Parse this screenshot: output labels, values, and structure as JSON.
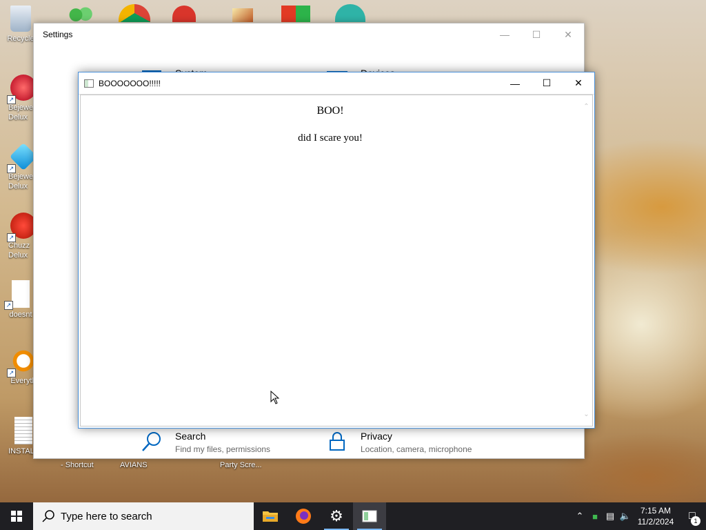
{
  "desktop": {
    "icons": [
      {
        "label": "Recycle"
      },
      {
        "label": "Bejewe Delux"
      },
      {
        "label": "Bejewe Delux"
      },
      {
        "label": "Chuzz Delux"
      },
      {
        "label": "doesnt"
      },
      {
        "label": "Everyth"
      },
      {
        "label": "INSTALL"
      }
    ],
    "bottom_labels": [
      "- Shortcut",
      "AVIANS",
      "Party Scre..."
    ]
  },
  "settings": {
    "title": "Settings",
    "tiles": {
      "system": {
        "name": "System"
      },
      "devices": {
        "name": "Devices"
      },
      "search": {
        "name": "Search",
        "desc": "Find my files, permissions"
      },
      "privacy": {
        "name": "Privacy",
        "desc": "Location, camera, microphone"
      }
    }
  },
  "popup": {
    "title": "BOOOOOOO!!!!!",
    "heading": "BOO!",
    "message": "did I scare you!"
  },
  "taskbar": {
    "search_placeholder": "Type here to search",
    "clock_time": "7:15 AM",
    "clock_date": "11/2/2024",
    "notification_count": "1"
  }
}
